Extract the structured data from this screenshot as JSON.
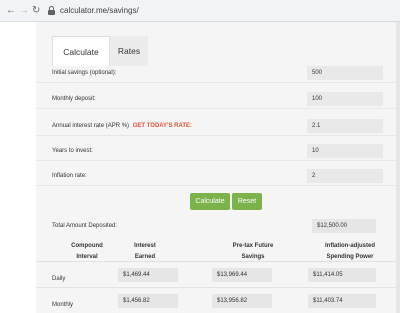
{
  "browser": {
    "back_icon": "←",
    "forward_icon": "→",
    "reload_icon": "↻",
    "url": "calculator.me/savings/"
  },
  "tabs": [
    {
      "label": "Calculate",
      "active": true
    },
    {
      "label": "Rates",
      "active": false
    }
  ],
  "form": {
    "initial_savings": {
      "label": "Initial savings (optional):",
      "value": "500"
    },
    "monthly_deposit": {
      "label": "Monthly deposit:",
      "value": "100"
    },
    "annual_rate": {
      "label": "Annual interest rate (APR %)",
      "link": "GET TODAY'S RATE:",
      "value": "2.1"
    },
    "years": {
      "label": "Years to invest:",
      "value": "10"
    },
    "inflation": {
      "label": "Inflation rate:",
      "value": "2"
    }
  },
  "buttons": {
    "calculate": "Calculate",
    "reset": "Reset"
  },
  "total": {
    "label": "Total Amount Deposited:",
    "value": "$12,500.00"
  },
  "table": {
    "headers": [
      {
        "line1": "Compound",
        "line2": "Interval"
      },
      {
        "line1": "Interest",
        "line2": "Earned"
      },
      {
        "line1": "Pre-tax Future",
        "line2": "Savings"
      },
      {
        "line1": "Inflation-adjusted",
        "line2": "Spending Power"
      }
    ],
    "rows": [
      {
        "interval": "Daily",
        "interest": "$1,469.44",
        "savings": "$13,969.44",
        "spending": "$11,414.05"
      },
      {
        "interval": "Monthly",
        "interest": "$1,456.82",
        "savings": "$13,956.82",
        "spending": "$11,403.74"
      }
    ]
  },
  "colors": {
    "accent_button": "#7bb24a",
    "rate_link": "#e0523a"
  }
}
